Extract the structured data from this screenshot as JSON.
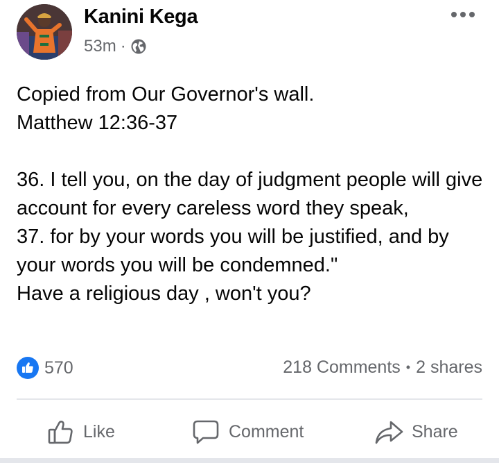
{
  "post": {
    "author": "Kanini Kega",
    "time": "53m",
    "separator": "·",
    "privacy_icon": "globe-icon",
    "more_icon": "more-horizontal-icon",
    "text": "Copied from Our Governor's wall.\nMatthew 12:36-37\n\n36. I tell you, on the day of judgment people will give account for every careless word they speak,\n37. for by your words you will be justified, and by your words you will be condemned.\"\nHave a religious day , won't you?"
  },
  "stats": {
    "reaction_icon": "like-reaction-icon",
    "reaction_count": "570",
    "comments": "218 Comments",
    "bullet": "•",
    "shares": "2 shares"
  },
  "actions": {
    "like_label": "Like",
    "comment_label": "Comment",
    "share_label": "Share"
  },
  "colors": {
    "accent": "#1877f2",
    "muted_text": "#65676b",
    "divider": "#e4e6eb"
  }
}
